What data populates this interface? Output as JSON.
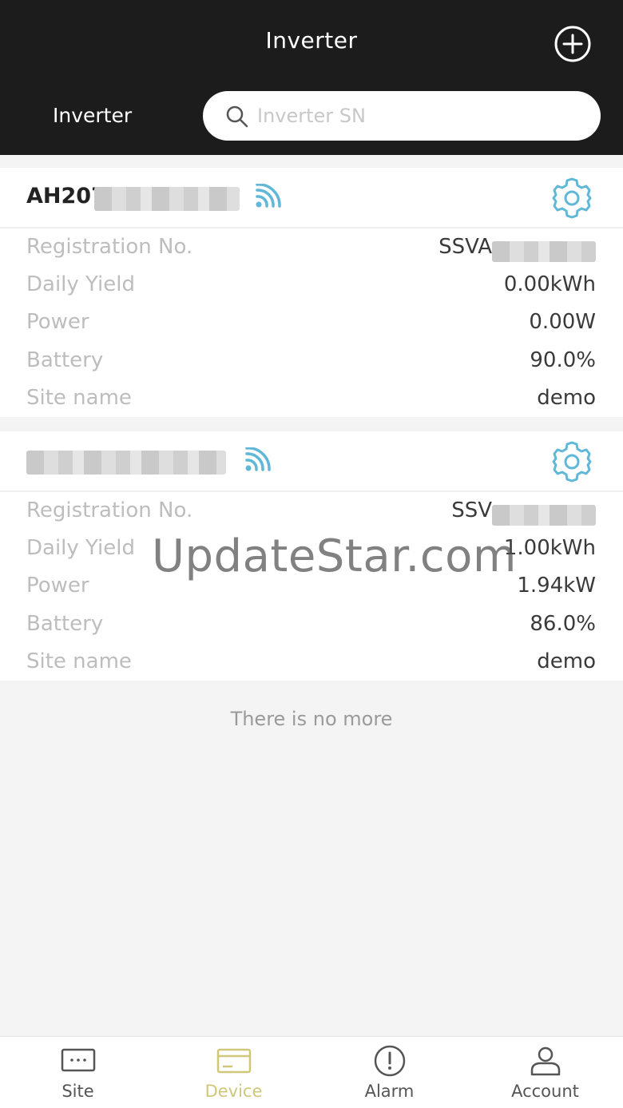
{
  "header": {
    "title": "Inverter",
    "add_icon": "plus-circle-icon",
    "filter_label": "Inverter",
    "search_placeholder": "Inverter SN",
    "search_value": ""
  },
  "colors": {
    "header_bg": "#1c1c1c",
    "accent": "#5fb8d8",
    "active_tab": "#cfc77a",
    "label_gray": "#bdbdbd"
  },
  "inverters": [
    {
      "sn_prefix": "AH207",
      "rows": [
        {
          "label": "Registration No.",
          "value": "SSVA"
        },
        {
          "label": "Daily Yield",
          "value": "0.00kWh"
        },
        {
          "label": "Power",
          "value": "0.00W"
        },
        {
          "label": "Battery",
          "value": "90.0%"
        },
        {
          "label": "Site name",
          "value": "demo"
        }
      ]
    },
    {
      "sn_prefix": "",
      "rows": [
        {
          "label": "Registration No.",
          "value": "SSV"
        },
        {
          "label": "Daily Yield",
          "value": "1.00kWh"
        },
        {
          "label": "Power",
          "value": "1.94kW"
        },
        {
          "label": "Battery",
          "value": "86.0%"
        },
        {
          "label": "Site name",
          "value": "demo"
        }
      ]
    }
  ],
  "list_end_text": "There is no more",
  "watermark": "UpdateStar.com",
  "tabs": [
    {
      "label": "Site",
      "icon": "site-monitor-icon"
    },
    {
      "label": "Device",
      "icon": "device-card-icon",
      "active": true
    },
    {
      "label": "Alarm",
      "icon": "alarm-exclamation-icon"
    },
    {
      "label": "Account",
      "icon": "account-person-icon"
    }
  ]
}
